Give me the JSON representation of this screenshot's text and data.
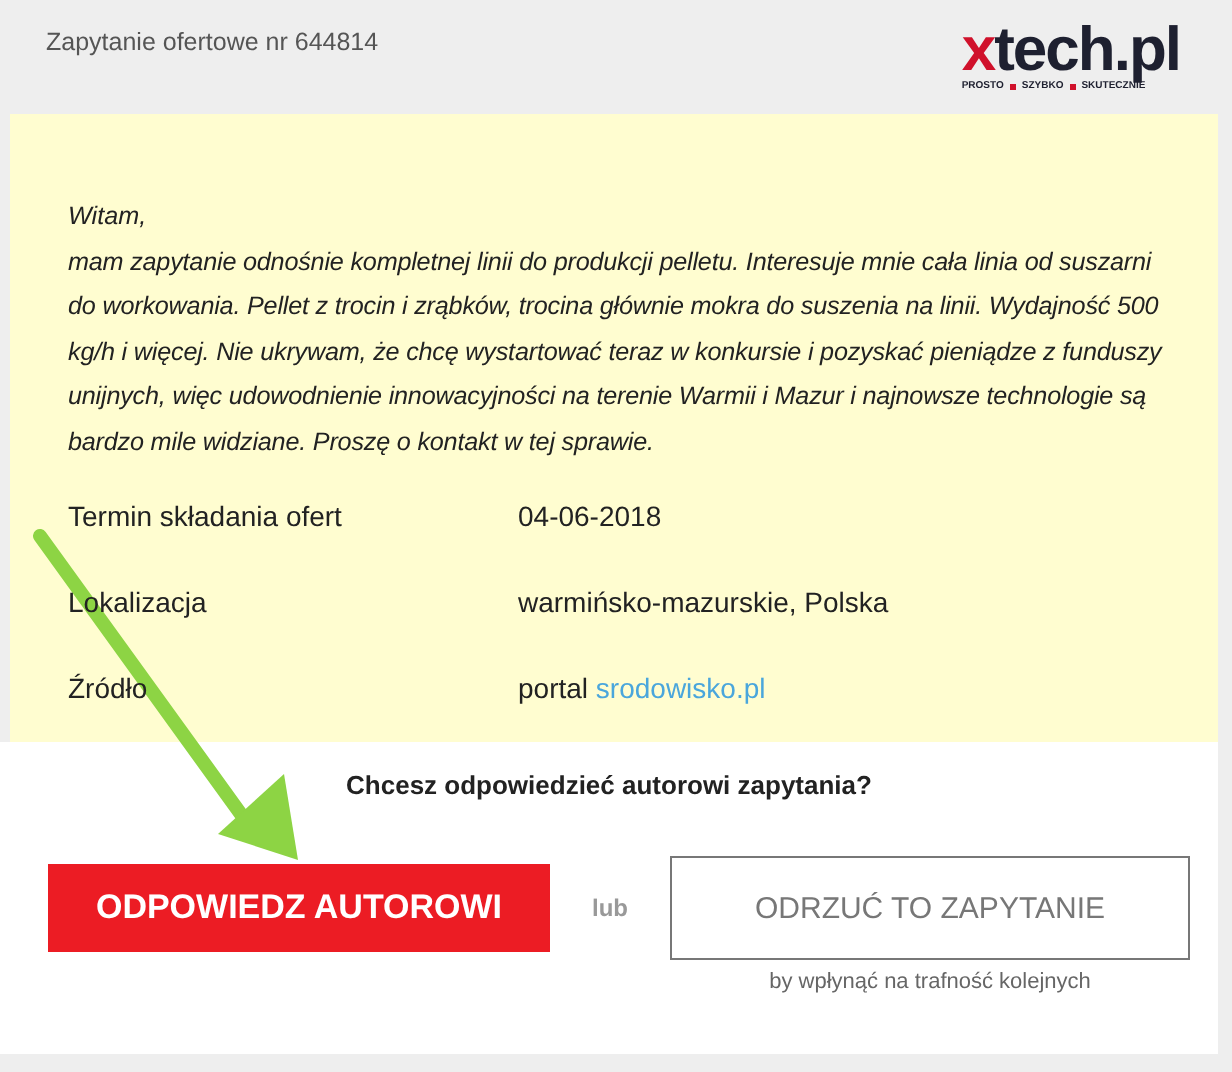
{
  "header": {
    "title": "Zapytanie ofertowe nr 644814",
    "logo": {
      "accent": "x",
      "name": "tech.pl",
      "tagline": [
        "PROSTO",
        "SZYBKO",
        "SKUTECZNIE"
      ]
    }
  },
  "message": {
    "greeting": "Witam,",
    "body": "mam zapytanie odnośnie kompletnej linii do produkcji pelletu. Interesuje mnie cała linia od suszarni do workowania. Pellet z trocin i zrąbków, trocina głównie mokra do suszenia na linii. Wydajność 500 kg/h i więcej. Nie ukrywam, że chcę wystartować teraz w konkursie i pozyskać pieniądze z funduszy unijnych, więc udowodnienie innowacyjności na terenie Warmii i Mazur i najnowsze technologie są bardzo mile widziane. Proszę o kontakt w tej sprawie."
  },
  "details": [
    {
      "label": "Termin składania ofert",
      "value": "04-06-2018"
    },
    {
      "label": "Lokalizacja",
      "value": "warmińsko-mazurskie, Polska"
    },
    {
      "label": "Źródło",
      "value": "portal",
      "link": "srodowisko.pl"
    }
  ],
  "question": "Chcesz odpowiedzieć autorowi zapytania?",
  "actions": {
    "reply": "ODPOWIEDZ AUTOROWI",
    "or": "lub",
    "reject": "ODRZUĆ TO ZAPYTANIE",
    "reject_note": "by wpłynąć na trafność kolejnych"
  }
}
